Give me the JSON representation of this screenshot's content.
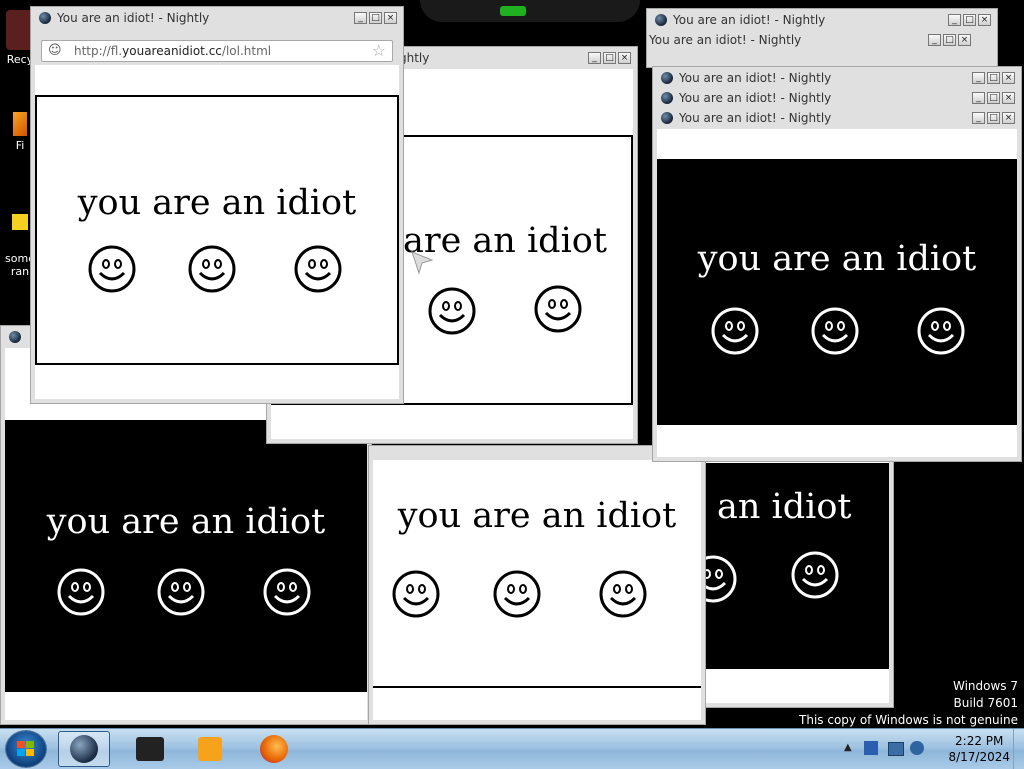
{
  "desktop_icons": [
    {
      "label": "Recy"
    },
    {
      "label": "Fi"
    },
    {
      "label": "some"
    },
    {
      "label": "ran"
    }
  ],
  "windows": [
    {
      "title": "You are an idiot! - Nightly",
      "url_prefix": "http://fl.",
      "url_domain": "youareanidiot.cc",
      "url_path": "/lol.html"
    },
    {
      "title": "You are an idiot! - Nightly"
    },
    {
      "title": "You are an idiot! - Nightly"
    },
    {
      "title": "You are an idiot! - Nightly"
    },
    {
      "title": "You are an idiot! - Nightly"
    },
    {
      "title": "You are an idiot! - Nightly"
    },
    {
      "title_fragment": "ghtly"
    }
  ],
  "message": "you are an idiot",
  "partial_messages": [
    "are an idiot",
    "an idiot"
  ],
  "icons": {
    "smiley": "smiley-face-icon",
    "site": "smiley-site-icon",
    "bookmark": "star-icon"
  },
  "window_controls": {
    "minimize": "_",
    "maximize": "□",
    "close": "×"
  },
  "watermark": {
    "line1": "Windows 7",
    "line2": "Build 7601",
    "line3": "This copy of Windows is not genuine"
  },
  "clock": {
    "time": "2:22 PM",
    "date": "8/17/2024"
  },
  "colors": {
    "black": "#000000",
    "white": "#ffffff",
    "taskbar": "#9fc3e2",
    "accent": "#1fb11f"
  }
}
